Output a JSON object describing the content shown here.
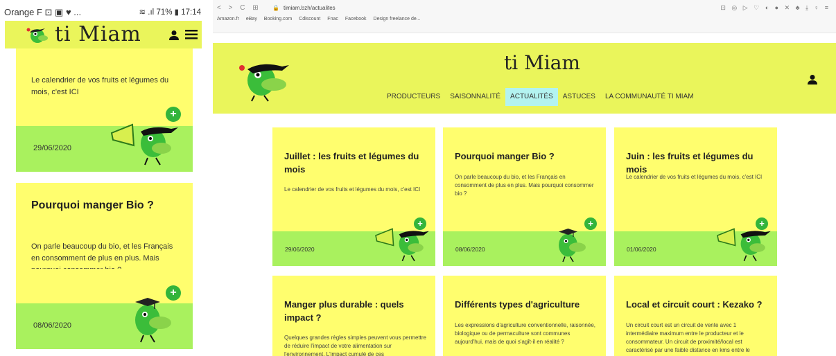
{
  "mobile": {
    "status_bar": {
      "carrier": "Orange F",
      "carrier_icons": "⊡ ▣ ♥ ...",
      "battery": "71%",
      "time": "17:14",
      "signal": "≋ .ıl"
    },
    "header": {
      "logo": "ti Miam",
      "user_icon": "user-icon",
      "menu_icon": "hamburger-menu-icon"
    },
    "cards": [
      {
        "title": "",
        "desc": "Le calendrier de vos fruits et légumes du mois, c'est ICI",
        "date": "29/06/2020",
        "plus": "+"
      },
      {
        "title": "Pourquoi manger Bio ?",
        "desc": "On parle beaucoup du bio, et les Français en consomment de plus en plus. Mais pourquoi consommer bio ?",
        "date": "08/06/2020",
        "plus": "+"
      }
    ]
  },
  "browser": {
    "toolbar": {
      "nav": "< > C ⊞",
      "url": "timiam.bzh/actualites",
      "extensions": "⊡ ◎ ▷ ♡ ◐ ● ✕ ♣ ⤓ ♀ ≡"
    },
    "bookmarks": [
      "Amazon.fr",
      "eBay",
      "Booking.com",
      "Cdiscount",
      "Fnac",
      "Facebook",
      "Design freelance de..."
    ],
    "site": {
      "logo": "ti Miam",
      "menu": [
        "PRODUCTEURS",
        "SAISONNALITÉ",
        "ACTUALITÉS",
        "ASTUCES",
        "LA COMMUNAUTÉ TI MIAM"
      ],
      "active_menu": "ACTUALITÉS"
    },
    "cards": [
      {
        "title": "Juillet : les fruits et légumes du mois",
        "desc": "Le calendrier de vos fruits et légumes du mois, c'est ICI",
        "date": "29/06/2020",
        "plus": "+"
      },
      {
        "title": "Pourquoi manger Bio ?",
        "desc": "On parle beaucoup du bio, et les Français en consomment de plus en plus. Mais pourquoi consommer bio ?",
        "date": "08/06/2020",
        "plus": "+"
      },
      {
        "title": "Juin : les fruits et légumes du mois",
        "desc": "Le calendrier de vos fruits et légumes du mois, c'est ICI",
        "date": "01/06/2020",
        "plus": "+"
      },
      {
        "title": "Manger plus durable : quels impact ?",
        "desc": "Quelques grandes règles simples peuvent vous permettre de réduire l'impact de votre alimentation sur l'environnement. L'impact cumulé de ces"
      },
      {
        "title": "Différents types d'agriculture",
        "desc": "Les expressions d'agriculture conventionnelle, raisonnée, biologique ou de permaculture sont communes aujourd'hui, mais de quoi s'agît-il en réalité ?"
      },
      {
        "title": "Local et circuit court : Kezako ?",
        "desc": "Un circuit court est un circuit de vente avec 1 intermédiaire maximum entre le producteur et le consommateur. Un circuit de proximité/local est caractérisé par une faible distance en kms entre le"
      }
    ]
  },
  "colors": {
    "header_yellow": "#eaf55b",
    "card_yellow": "#fffe6e",
    "card_green": "#a9f15e",
    "plus_green": "#33b43b",
    "active_tab": "#b3f3f0"
  }
}
